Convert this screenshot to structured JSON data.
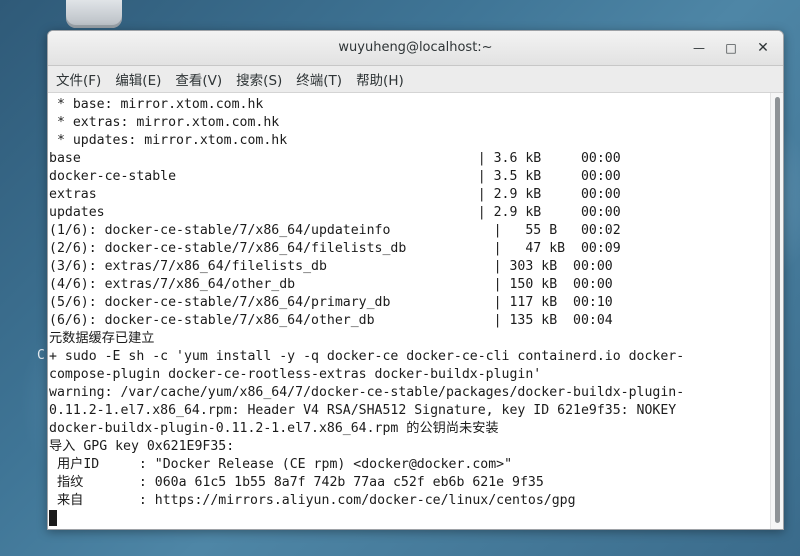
{
  "desktop": {
    "glyph": "C"
  },
  "window": {
    "title": "wuyuheng@localhost:~",
    "buttons": {
      "minimize": "—",
      "maximize": "□",
      "close": "✕"
    }
  },
  "menu": [
    "文件(F)",
    "编辑(E)",
    "查看(V)",
    "搜索(S)",
    "终端(T)",
    "帮助(H)"
  ],
  "terminal": {
    "lines": [
      " * base: mirror.xtom.com.hk",
      " * extras: mirror.xtom.com.hk",
      " * updates: mirror.xtom.com.hk",
      "base                                                  | 3.6 kB     00:00",
      "docker-ce-stable                                      | 3.5 kB     00:00",
      "extras                                                | 2.9 kB     00:00",
      "updates                                               | 2.9 kB     00:00",
      "(1/6): docker-ce-stable/7/x86_64/updateinfo             |   55 B   00:02",
      "(2/6): docker-ce-stable/7/x86_64/filelists_db           |   47 kB  00:09",
      "(3/6): extras/7/x86_64/filelists_db                     | 303 kB  00:00",
      "(4/6): extras/7/x86_64/other_db                         | 150 kB  00:00",
      "(5/6): docker-ce-stable/7/x86_64/primary_db             | 117 kB  00:10",
      "(6/6): docker-ce-stable/7/x86_64/other_db               | 135 kB  00:04",
      "元数据缓存已建立",
      "+ sudo -E sh -c 'yum install -y -q docker-ce docker-ce-cli containerd.io docker-",
      "compose-plugin docker-ce-rootless-extras docker-buildx-plugin'",
      "warning: /var/cache/yum/x86_64/7/docker-ce-stable/packages/docker-buildx-plugin-",
      "0.11.2-1.el7.x86_64.rpm: Header V4 RSA/SHA512 Signature, key ID 621e9f35: NOKEY",
      "docker-buildx-plugin-0.11.2-1.el7.x86_64.rpm 的公钥尚未安装",
      "导入 GPG key 0x621E9F35:",
      " 用户ID     : \"Docker Release (CE rpm) <docker@docker.com>\"",
      " 指纹       : 060a 61c5 1b55 8a7f 742b 77aa c52f eb6b 621e 9f35",
      " 来自       : https://mirrors.aliyun.com/docker-ce/linux/centos/gpg"
    ]
  }
}
